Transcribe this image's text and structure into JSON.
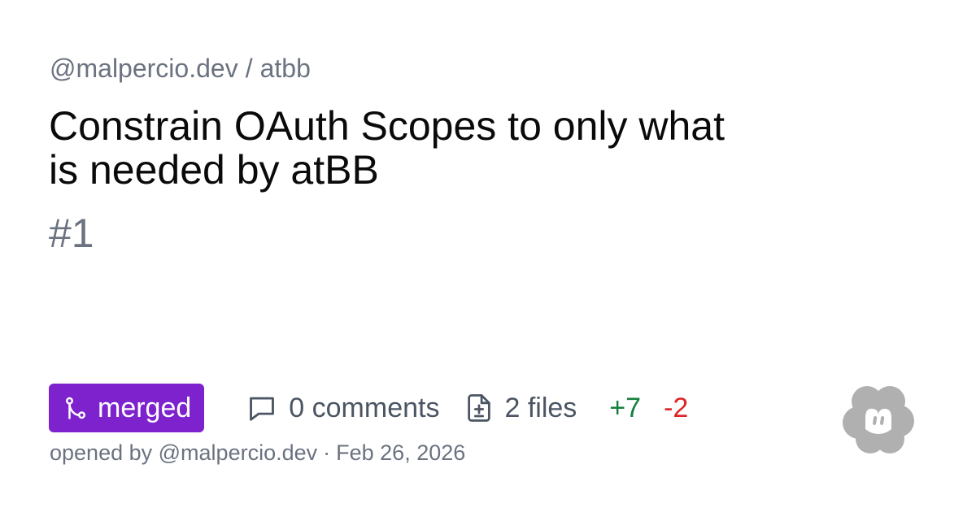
{
  "repo": {
    "owner": "@malpercio.dev",
    "separator": "/",
    "name": "atbb"
  },
  "pull_request": {
    "title": "Constrain OAuth Scopes to only what is needed by atBB",
    "number": "#1",
    "status": "merged",
    "status_color": "#7e22ce",
    "comments": "0 comments",
    "files": "2 files",
    "additions": "+7",
    "additions_color": "#15803d",
    "deletions": "-2",
    "deletions_color": "#dc2626",
    "opened_prefix": "opened by",
    "opened_by": "@malpercio.dev",
    "opened_separator": "·",
    "opened_date": "Feb 26, 2026"
  },
  "icons": {
    "status": "git-merge-icon",
    "comments": "comment-icon",
    "files": "file-diff-icon",
    "logo": "tangled-logo-icon"
  }
}
